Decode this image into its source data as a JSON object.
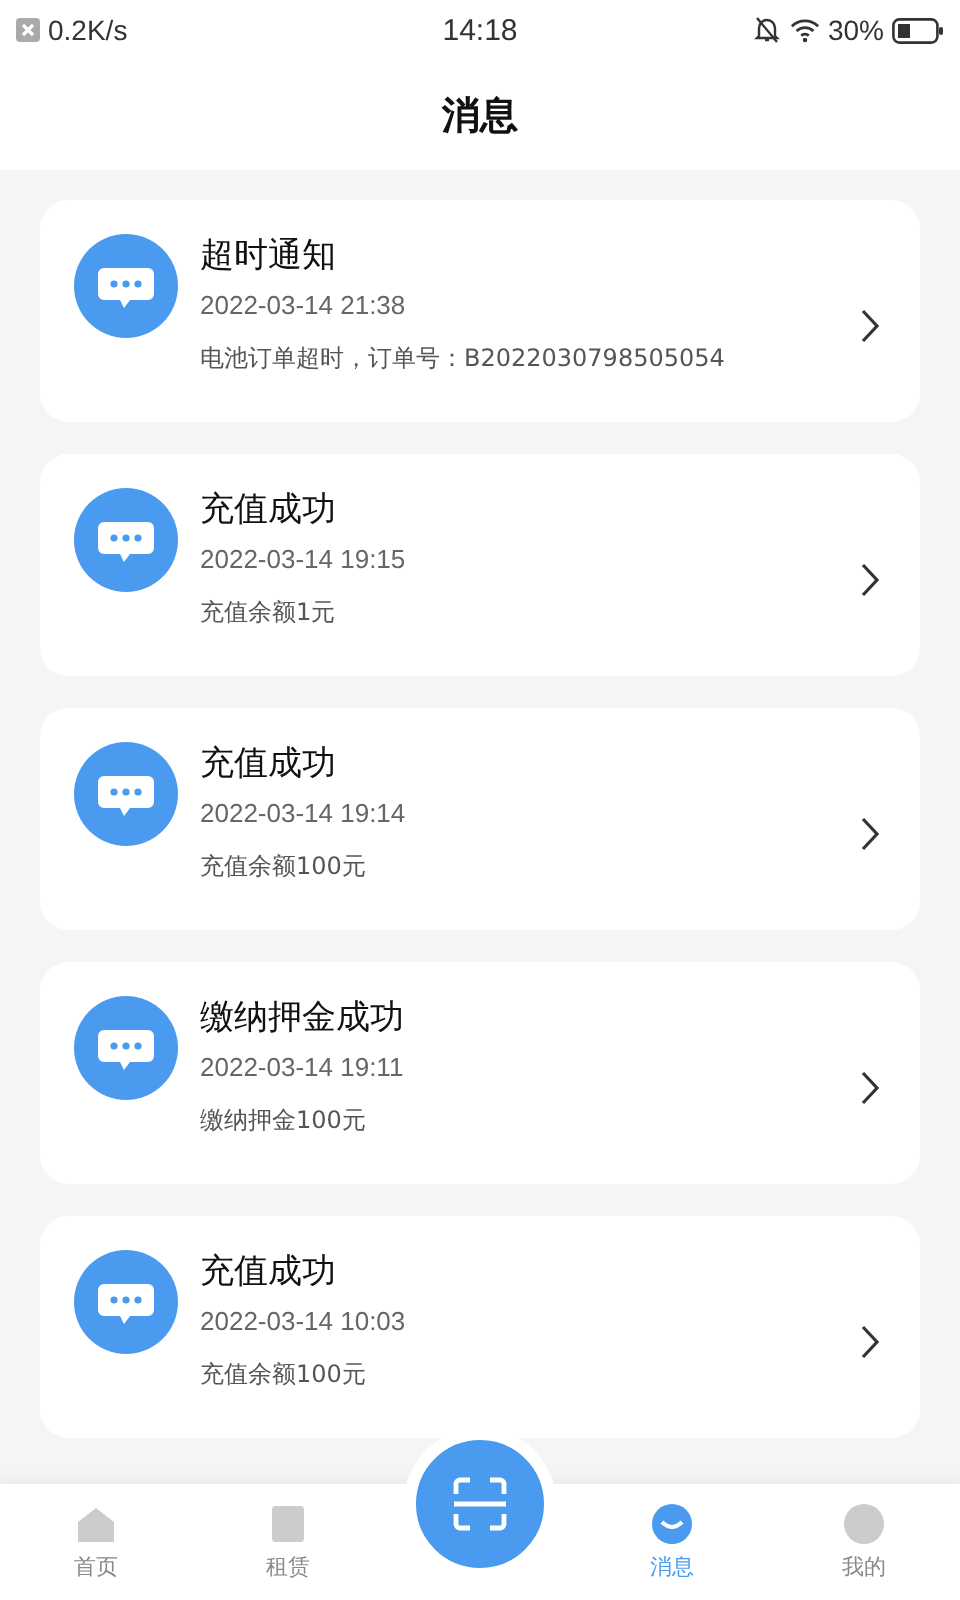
{
  "status_bar": {
    "speed": "0.2K/s",
    "time": "14:18",
    "battery": "30%"
  },
  "header": {
    "title": "消息"
  },
  "messages": [
    {
      "title": "超时通知",
      "time": "2022-03-14 21:38",
      "body": "电池订单超时，订单号：B2022030798505054"
    },
    {
      "title": "充值成功",
      "time": "2022-03-14 19:15",
      "body": "充值余额1元"
    },
    {
      "title": "充值成功",
      "time": "2022-03-14 19:14",
      "body": "充值余额100元"
    },
    {
      "title": "缴纳押金成功",
      "time": "2022-03-14 19:11",
      "body": "缴纳押金100元"
    },
    {
      "title": "充值成功",
      "time": "2022-03-14 10:03",
      "body": "充值余额100元"
    }
  ],
  "tab_bar": [
    {
      "kind": "home",
      "label": "首页",
      "selected": false
    },
    {
      "kind": "rent",
      "label": "租赁",
      "selected": false
    },
    {
      "kind": "scan"
    },
    {
      "kind": "message",
      "label": "消息",
      "selected": true
    },
    {
      "kind": "profile",
      "label": "我的",
      "selected": false
    }
  ]
}
